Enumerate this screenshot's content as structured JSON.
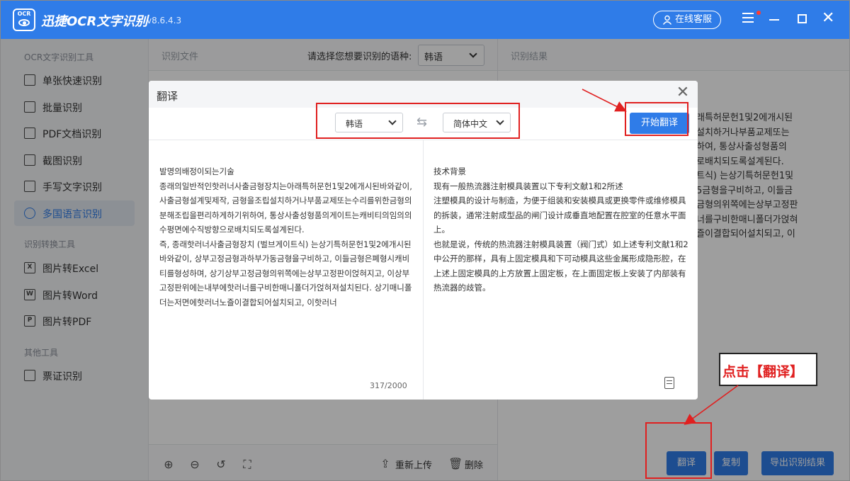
{
  "app": {
    "title": "迅捷OCR文字识别",
    "version": "v8.6.4.3",
    "logo_text": "OCR",
    "service_label": "在线客服"
  },
  "sidebar": {
    "sections": [
      {
        "label": "OCR文字识别工具",
        "items": [
          "单张快速识别",
          "批量识别",
          "PDF文档识别",
          "截图识别",
          "手写文字识别",
          "多国语言识别"
        ]
      },
      {
        "label": "识别转换工具",
        "items": [
          "图片转Excel",
          "图片转Word",
          "图片转PDF"
        ]
      },
      {
        "label": "其他工具",
        "items": [
          "票证识别"
        ]
      }
    ],
    "active": "多国语言识别"
  },
  "main": {
    "left_title": "识别文件",
    "lang_prompt": "请选择您想要识别的语种:",
    "lang_value": "韩语",
    "right_title": "识别结果",
    "result_text": "래특허문헌1및2에개시된\n설치하거나부품교제또는\n하여, 통상사출성형품의\n로배치되도록설계된다.\n트식) 는상기특허문헌1및\n5금형을구비하고, 이들금\n금형의위쪽에는상부고정판\n너를구비한매니폴더가얹혀\n즐이결합되어설치되고, 이",
    "toolbar": {
      "reupload": "重新上传",
      "delete": "删除"
    },
    "buttons": {
      "translate": "翻译",
      "copy": "复制",
      "export": "导出识别结果"
    }
  },
  "modal": {
    "title": "翻译",
    "source_lang": "韩语",
    "target_lang": "简体中文",
    "start_button": "开始翻译",
    "source_text": "발명의배정이되는기술\n        종래의일반적인핫러너사출금형장치는아래특허문헌1및2에개시된바와같이, 사출금형설계및제작, 금형을조립설치하거나부품교제또는수리를위한금형의분해조립을편리하게하기위하여, 통상사출성형품의게이트는캐비티의임의의수평면에수직방향으로배치되도록설계된다.\n        즉, 종래핫러너사출금형장치 (벌브게이트식) 는상기특허문헌1및2에개시된바와같이, 상부고정금형과하부가동금형을구비하고, 이들금형은폐형시캐비티를형성하며, 상기상부고정금형의위쪽에는상부고정판이얹혀지고, 이상부고정판위에는내부에핫러너를구비한매니폴더가얹혀져설치된다. 상기매니폴더는저면에핫러너노즐이결합되어설치되고, 이핫러너",
    "target_text": "技术背景\n现有一般热流器注射模具装置以下专利文献1和2所述\n注塑模具的设计与制造，为便于组装和安装模具或更换零件或维修模具的拆装，通常注射成型品的闸门设计成垂直地配置在腔室的任意水平面上。\n也就是说，传统的热流器注射模具装置（阀门式）如上述专利文献1和2中公开的那样，具有上固定模具和下可动模具这些金属形成隐形腔，在上述上固定模具的上方放置上固定板，在上面固定板上安装了内部装有热流器的歧管。",
    "char_count": "317/2000"
  },
  "annotation": {
    "callout": "点击【翻译】"
  },
  "colors": {
    "brand": "#2f7ce8",
    "annotation": "#e02020"
  }
}
